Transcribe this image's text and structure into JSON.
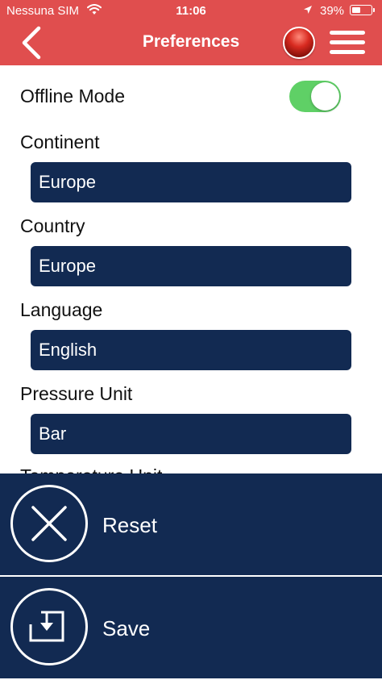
{
  "status_bar": {
    "carrier": "Nessuna SIM",
    "time": "11:06",
    "battery": "39%",
    "battery_level": 0.39
  },
  "nav": {
    "title": "Preferences",
    "back_icon": "chevron-left-icon",
    "menu_icon": "hamburger-menu-icon"
  },
  "settings": {
    "offline_mode": {
      "label": "Offline Mode",
      "enabled": true
    },
    "continent": {
      "label": "Continent",
      "value": "Europe"
    },
    "country": {
      "label": "Country",
      "value": "Europe"
    },
    "language": {
      "label": "Language",
      "value": "English"
    },
    "pressure_unit": {
      "label": "Pressure Unit",
      "value": "Bar"
    },
    "next_label_partial": "Temperature Unit"
  },
  "actions": {
    "reset": {
      "label": "Reset",
      "icon": "close-icon"
    },
    "save": {
      "label": "Save",
      "icon": "save-icon"
    }
  },
  "colors": {
    "header": "#e04e4e",
    "navy": "#122a52",
    "toggle_on": "#5fd066"
  }
}
